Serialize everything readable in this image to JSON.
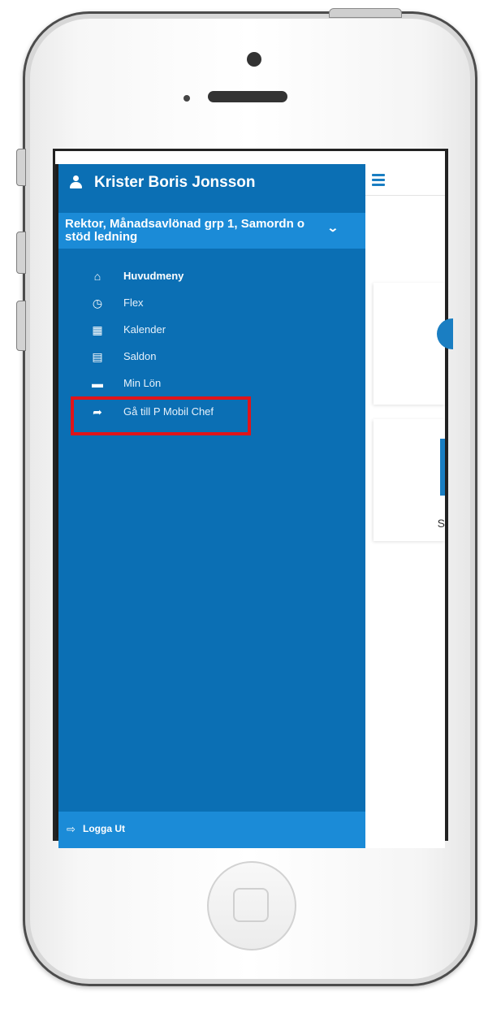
{
  "sidebar": {
    "user_name": "Krister Boris Jonsson",
    "role": "Rektor, Månadsavlönad grp 1, Samordn o stöd ledning",
    "items": [
      {
        "icon": "home-icon",
        "label": "Huvudmeny"
      },
      {
        "icon": "clock-icon",
        "label": "Flex"
      },
      {
        "icon": "calendar-icon",
        "label": "Kalender"
      },
      {
        "icon": "document-icon",
        "label": "Saldon"
      },
      {
        "icon": "credit-card-icon",
        "label": "Min Lön"
      },
      {
        "icon": "share-arrow-icon",
        "label": "Gå till P Mobil Chef"
      }
    ],
    "logout_label": "Logga Ut"
  },
  "main": {
    "card2_text": "S"
  },
  "colors": {
    "sidebar_bg": "#0b6fb4",
    "accent_bar": "#1b8bd7",
    "highlight": "#e0141a"
  }
}
